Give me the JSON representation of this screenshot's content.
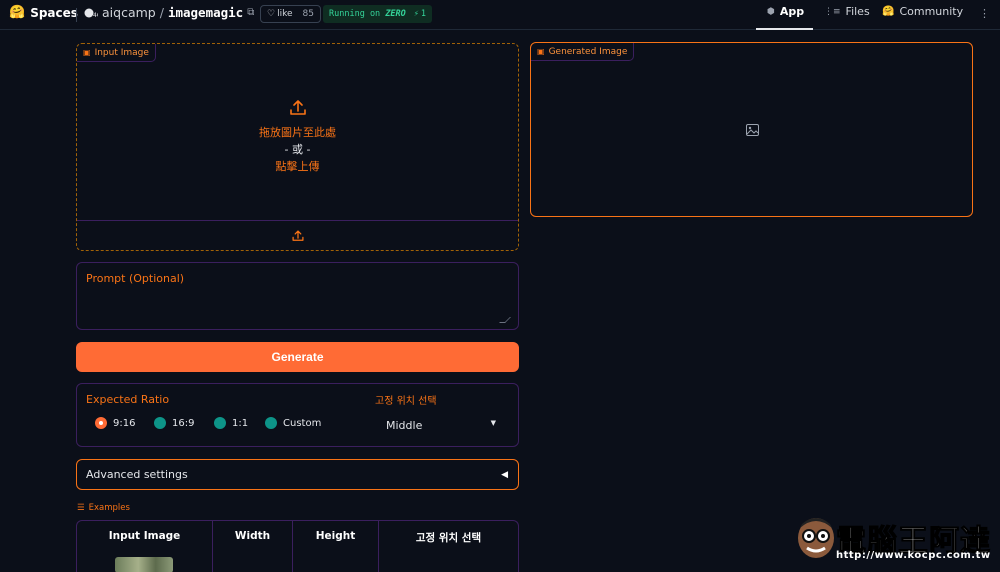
{
  "topbar": {
    "spaces_label": "Spaces",
    "owner": "aiqcamp",
    "slash": "/",
    "repo": "imagemagic",
    "like_label": "like",
    "like_count": "85",
    "status_prefix": "Running on",
    "status_hardware": "ZERO",
    "status_count": "1",
    "nav": {
      "app": "App",
      "files": "Files",
      "community": "Community"
    }
  },
  "input_image": {
    "label": "Input Image",
    "drop_text": "拖放圖片至此處",
    "or_text": "- 或 -",
    "click_text": "點擊上傳"
  },
  "generated_image": {
    "label": "Generated Image"
  },
  "prompt": {
    "label": "Prompt (Optional)",
    "value": ""
  },
  "generate_button": "Generate",
  "expected_ratio": {
    "label": "Expected Ratio",
    "options": [
      "9:16",
      "16:9",
      "1:1",
      "Custom"
    ],
    "selected": "9:16"
  },
  "fixed_position": {
    "label": "고정 위치 선택",
    "value": "Middle"
  },
  "advanced_settings": "Advanced settings",
  "examples": {
    "label": "Examples",
    "headers": [
      "Input Image",
      "Width",
      "Height",
      "고정 위치 선택"
    ]
  },
  "watermark": {
    "text": "電腦王阿達",
    "url": "http://www.kocpc.com.tw"
  },
  "colors": {
    "background": "#0b0f19",
    "accent": "#ff6b35",
    "radio": "#0d9488",
    "border": "#3b1f5e"
  }
}
